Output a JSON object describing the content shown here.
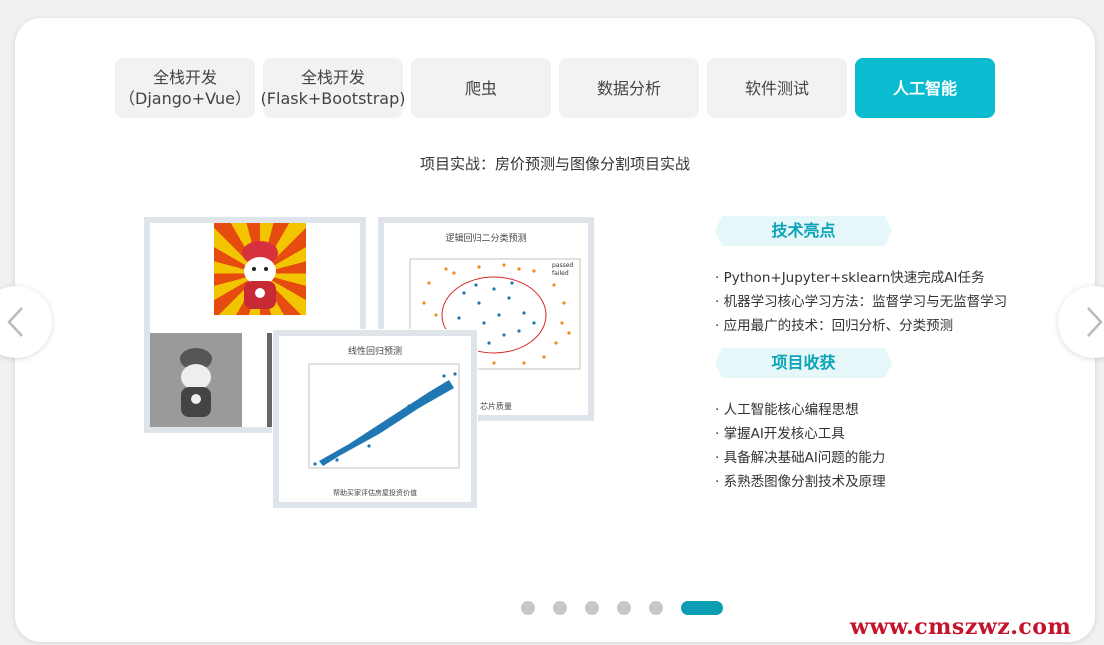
{
  "tabs": [
    {
      "line1": "全栈开发",
      "line2": "（Django+Vue）"
    },
    {
      "line1": "全栈开发",
      "line2": "(Flask+Bootstrap)"
    },
    {
      "line1": "爬虫",
      "line2": ""
    },
    {
      "line1": "数据分析",
      "line2": ""
    },
    {
      "line1": "软件测试",
      "line2": ""
    },
    {
      "line1": "人工智能",
      "line2": ""
    }
  ],
  "active_tab": 5,
  "subtitle": "项目实战：房价预测与图像分割项目实战",
  "images": {
    "chart1_title": "逻辑回归二分类预测",
    "chart1_legend": [
      "passed",
      "failed"
    ],
    "chart1_caption": "芯片质量",
    "chart2_title": "线性回归预测",
    "chart2_caption": "帮助买家评估房屋投资价值"
  },
  "highlights": {
    "title": "技术亮点",
    "items": [
      "· Python+Jupyter+sklearn快速完成AI任务",
      "· 机器学习核心学习方法：监督学习与无监督学习",
      "· 应用最广的技术：回归分析、分类预测"
    ]
  },
  "gains": {
    "title": "项目收获",
    "items": [
      "· 人工智能核心编程思想",
      "· 掌握AI开发核心工具",
      "· 具备解决基础AI问题的能力",
      "· 系熟悉图像分割技术及原理"
    ]
  },
  "nav": {
    "prev_icon": "chevron-left-icon",
    "next_icon": "chevron-right-icon"
  },
  "pagination": {
    "count": 6,
    "active": 5
  },
  "watermark": "www.cmszwz.com",
  "colors": {
    "accent": "#0bbcd0",
    "pill_text": "#0aa3b8",
    "dot_active": "#0b9eb2",
    "watermark": "#c4142b"
  }
}
